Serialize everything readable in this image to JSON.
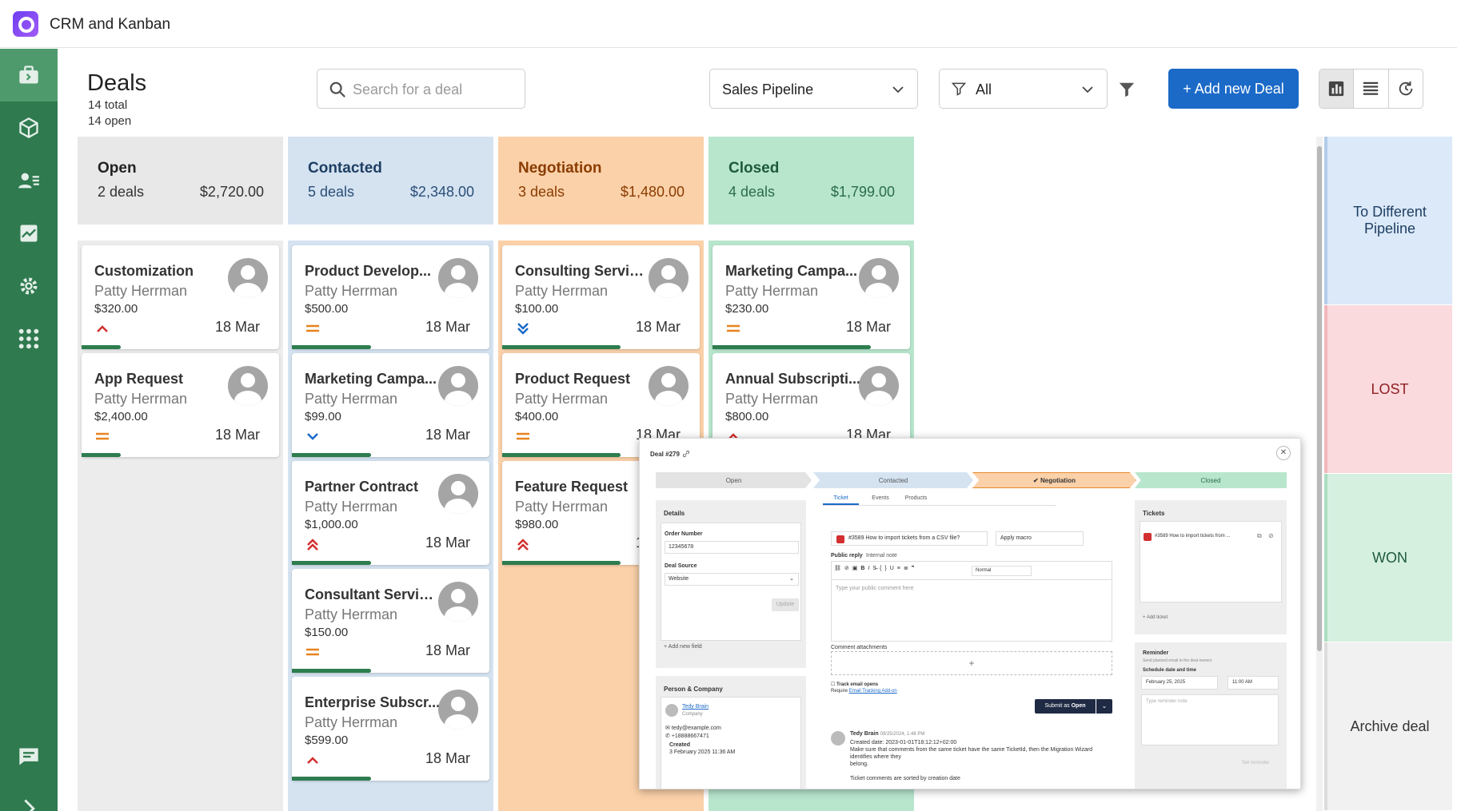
{
  "app": {
    "title": "CRM and Kanban"
  },
  "sidebar": {
    "items": [
      {
        "name": "deals"
      },
      {
        "name": "products"
      },
      {
        "name": "contacts"
      },
      {
        "name": "reports"
      },
      {
        "name": "settings"
      },
      {
        "name": "apps"
      },
      {
        "name": "messages"
      },
      {
        "name": "expand"
      }
    ]
  },
  "header": {
    "title": "Deals",
    "total": "14 total",
    "open": "14 open",
    "search_placeholder": "Search for a deal",
    "pipeline": "Sales Pipeline",
    "filter": "All",
    "add_button": "+ Add new Deal"
  },
  "colors": {
    "accent": "#1b6ac8",
    "sidebar": "#2f7a4f",
    "open": "#e8e8e8",
    "contacted": "#d5e3f1",
    "negotiation": "#fbd1a9",
    "closed": "#b8e6cd",
    "bar": "#2e7d4f"
  },
  "columns": [
    {
      "name": "Open",
      "deals": "2 deals",
      "amount": "$2,720.00",
      "cards": [
        {
          "title": "Customization",
          "person": "Patty Herrman",
          "amount": "$320.00",
          "date": "18 Mar",
          "priority": "high",
          "progress": 0.2
        },
        {
          "title": "App Request",
          "person": "Patty Herrman",
          "amount": "$2,400.00",
          "date": "18 Mar",
          "priority": "medium",
          "progress": 0.2
        }
      ]
    },
    {
      "name": "Contacted",
      "deals": "5 deals",
      "amount": "$2,348.00",
      "cards": [
        {
          "title": "Product Develop...",
          "person": "Patty Herrman",
          "amount": "$500.00",
          "date": "18 Mar",
          "priority": "medium",
          "progress": 0.4
        },
        {
          "title": "Marketing Campa...",
          "person": "Patty Herrman",
          "amount": "$99.00",
          "date": "18 Mar",
          "priority": "low",
          "progress": 0.4
        },
        {
          "title": "Partner Contract",
          "person": "Patty Herrman",
          "amount": "$1,000.00",
          "date": "18 Mar",
          "priority": "highest",
          "progress": 0.4
        },
        {
          "title": "Consultant Services",
          "person": "Patty Herrman",
          "amount": "$150.00",
          "date": "18 Mar",
          "priority": "medium",
          "progress": 0.4
        },
        {
          "title": "Enterprise Subscr...",
          "person": "Patty Herrman",
          "amount": "$599.00",
          "date": "18 Mar",
          "priority": "high",
          "progress": 0.4
        }
      ]
    },
    {
      "name": "Negotiation",
      "deals": "3 deals",
      "amount": "$1,480.00",
      "cards": [
        {
          "title": "Consulting Services",
          "person": "Patty Herrman",
          "amount": "$100.00",
          "date": "18 Mar",
          "priority": "lowest",
          "progress": 0.6
        },
        {
          "title": "Product Request",
          "person": "Patty Herrman",
          "amount": "$400.00",
          "date": "18 Mar",
          "priority": "medium",
          "progress": 0.6
        },
        {
          "title": "Feature Request",
          "person": "Patty Herrman",
          "amount": "$980.00",
          "date": "18 Mar",
          "priority": "highest",
          "progress": 0.6
        }
      ]
    },
    {
      "name": "Closed",
      "deals": "4 deals",
      "amount": "$1,799.00",
      "cards": [
        {
          "title": "Marketing Campa...",
          "person": "Patty Herrman",
          "amount": "$230.00",
          "date": "18 Mar",
          "priority": "medium",
          "progress": 0.8
        },
        {
          "title": "Annual Subscripti...",
          "person": "Patty Herrman",
          "amount": "$800.00",
          "date": "18 Mar",
          "priority": "high",
          "progress": 0.8
        }
      ]
    }
  ],
  "drop_zones": [
    "To Different Pipeline",
    "LOST",
    "WON",
    "Archive deal"
  ],
  "modal": {
    "title": "Deal #279",
    "stages": [
      "Open",
      "Contacted",
      "Negotiation",
      "Closed"
    ],
    "details_title": "Details",
    "order_label": "Order Number",
    "order_value": "12345678",
    "source_label": "Deal Source",
    "source_value": "Website",
    "update": "Update",
    "add_field": "+ Add new field",
    "person_title": "Person & Company",
    "person_name": "Tedy Brain",
    "person_company": "Company",
    "person_email": "tedy@example.com",
    "person_phone": "+18888667471",
    "created_label": "Created",
    "created_value": "3 February 2025 11:36 AM",
    "tabs": [
      "Ticket",
      "Events",
      "Products"
    ],
    "ticket_select": "#3589 How to import tickets from a CSV file?",
    "macro": "Apply macro",
    "public_reply": "Public reply",
    "internal_note": "Internal note",
    "format": "Normal",
    "comment_placeholder": "Type your public comment here",
    "attachments": "Comment attachments",
    "track": "Track email opens",
    "require": "Require",
    "require_link": "Email Tracking Add-on",
    "submit": "Submit as",
    "submit_status": "Open",
    "comment_author": "Tedy Brain",
    "comment_time": "09/25/2024, 1:48 PM",
    "comment_lines": [
      "Created date: 2023-01-01T18:12:12+02:00",
      "Make sure that comments from the same ticket have the same TicketId, then the Migration Wizard",
      "identifies where they",
      "belong.",
      "",
      "Ticket comments are sorted by creation date"
    ],
    "tickets_title": "Tickets",
    "ticket_item": "#3589 How to import tickets from ...",
    "add_ticket": "+ Add ticket",
    "reminder_title": "Reminder",
    "reminder_sub": "Send planned email to the deal owners",
    "schedule_label": "Schedule date and time",
    "date_value": "February 25, 2025",
    "time_value": "11:00 AM",
    "reminder_placeholder": "Type reminder note",
    "set_reminder": "Set reminder"
  }
}
